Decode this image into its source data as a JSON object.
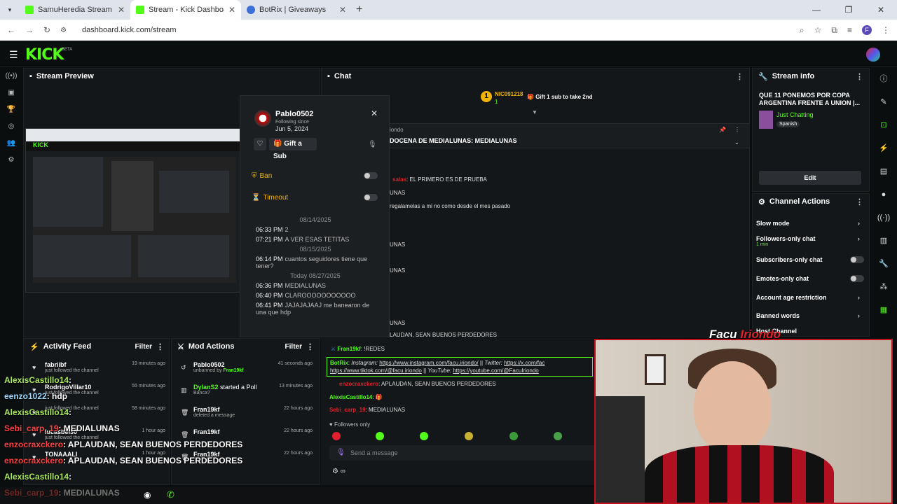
{
  "browser": {
    "tabs": [
      {
        "title": "SamuHeredia Stream - Watch L",
        "active": false
      },
      {
        "title": "Stream - Kick Dashboard",
        "active": true
      },
      {
        "title": "BotRix | Giveaways",
        "active": false
      }
    ],
    "url": "dashboard.kick.com/stream",
    "profile_initial": "F"
  },
  "kick": {
    "logo": "KICK",
    "beta": "BETA"
  },
  "stream_preview": {
    "title": "Stream Preview"
  },
  "popup": {
    "username": "Pablo0502",
    "following_since_label": "Following since",
    "following_since": "Jun 5, 2024",
    "gift_label": "Gift a Sub",
    "ban_label": "Ban",
    "timeout_label": "Timeout",
    "history": [
      {
        "type": "date",
        "text": "08/14/2025"
      },
      {
        "type": "msg",
        "time": "06:33 PM",
        "text": "2"
      },
      {
        "type": "msg",
        "time": "07:21 PM",
        "text": "A VER ESAS TETITAS"
      },
      {
        "type": "date",
        "text": "08/15/2025"
      },
      {
        "type": "msg",
        "time": "06:14 PM",
        "text": "cuantos seguidores tiene que tener?"
      },
      {
        "type": "date",
        "text": "Today 08/27/2025"
      },
      {
        "type": "msg",
        "time": "06:36 PM",
        "text": "MEDIALUNAS"
      },
      {
        "type": "msg",
        "time": "06:40 PM",
        "text": "CLAROOOOOOOOOOO"
      },
      {
        "type": "msg",
        "time": "06:41 PM",
        "text": "JAJAJAJAAJ me banearon de una que hdp"
      }
    ]
  },
  "chat": {
    "title": "Chat",
    "top_gifter": {
      "rank": "1",
      "name": "NIC091218",
      "count": "1",
      "cta": "Gift 1 sub to take 2nd"
    },
    "pinned_author": "iondo",
    "pinned_text": "DOCENA DE MEDIALUNAS: MEDIALUNAS",
    "messages": [
      {
        "user": "salas",
        "text": ": EL PRIMERO ES DE PRUEBA",
        "color": "#e0202c"
      },
      {
        "user": "",
        "text": "UNAS",
        "color": "#ddd"
      },
      {
        "user": "",
        "text": "regalamelas a mi no como desde el mes pasado",
        "color": "#ddd"
      },
      {
        "user": "",
        "text": "UNAS",
        "color": "#ddd"
      },
      {
        "user": "",
        "text": "UNAS",
        "color": "#ddd"
      },
      {
        "user": "",
        "text": "UNAS",
        "color": "#ddd"
      },
      {
        "user": "",
        "text": "LAUDAN, SEAN BUENOS PERDEDORES",
        "color": "#ddd"
      }
    ],
    "low": {
      "m1_user": "Fran19kf",
      "m1_text": ": !REDES",
      "bot_user": "BotRix",
      "bot_ig_label": "Instagram:",
      "bot_ig": "https://www.instagram.com/facu.iriondo/",
      "bot_tw_label": "Twitter:",
      "bot_tw": "https://x.com/fac",
      "bot_tt": "https://www.tiktok.com/@facu.iriondo",
      "bot_yt_label": "YouTube:",
      "bot_yt": "https://youtube.com/@FacuIriondo",
      "m3_user": "enzocraxckero",
      "m3_text": ": APLAUDAN, SEAN BUENOS PERDEDORES",
      "m4_user": "AlexisCastillo14",
      "m4_text": ":",
      "m5_user": "Sebi_carp_19",
      "m5_text": ": MEDIALUNAS",
      "followers_only": "Followers only",
      "send_placeholder": "Send a message"
    }
  },
  "activity": {
    "title": "Activity Feed",
    "filter": "Filter",
    "items": [
      {
        "name": "fabriibf",
        "sub": "just followed the channel",
        "time": "19 minutes ago"
      },
      {
        "name": "RodrigoVillar10",
        "sub": "just followed the channel",
        "time": "55 minutes ago"
      },
      {
        "name": "",
        "sub": "just followed the channel",
        "time": "58 minutes ago"
      },
      {
        "name": "lucasbel30",
        "sub": "just followed the channel",
        "time": "1 hour ago"
      },
      {
        "name": "TONAAALI",
        "sub": "",
        "time": "1 hour ago"
      }
    ]
  },
  "mod": {
    "title": "Mod Actions",
    "filter": "Filter",
    "items": [
      {
        "name": "Pablo0502",
        "sub": "unbanned by",
        "by": "Fran19kf",
        "time": "41 seconds ago"
      },
      {
        "name": "DylanS2",
        "action": " started a Poll",
        "sub": "Banca?",
        "time": "13 minutes ago"
      },
      {
        "name": "Fran19kf",
        "sub": "deleted a message",
        "time": "22 hours ago"
      },
      {
        "name": "Fran19kf",
        "sub": "",
        "time": "22 hours ago"
      },
      {
        "name": "Fran19kf",
        "sub": "",
        "time": "22 hours ago"
      }
    ]
  },
  "overlay_chat": [
    {
      "user": "AlexisCastillo14",
      "text": ":",
      "color": "#a8e85a"
    },
    {
      "user": "eenzo1022",
      "text": ": hdp",
      "color": "#9ad8ff"
    },
    {
      "user": "AlexisCastillo14",
      "text": ":",
      "color": "#a8e85a"
    },
    {
      "user": "Sebi_carp_19",
      "text": ": MEDIALUNAS",
      "color": "#ff4040"
    },
    {
      "user": "enzocraxckero",
      "text": ": APLAUDAN, SEAN BUENOS PERDEDORES",
      "color": "#ff4040"
    },
    {
      "user": "enzocraxckero",
      "text": ": APLAUDAN, SEAN BUENOS PERDEDORES",
      "color": "#ff4040"
    },
    {
      "user": "AlexisCastillo14",
      "text": ":",
      "color": "#a8e85a"
    },
    {
      "user": "Sebi_carp_19",
      "text": ": MEDIALUNAS",
      "color": "#ff4040"
    }
  ],
  "stream_info": {
    "title": "Stream info",
    "stream_title": "QUE 11 PONEMOS POR COPA ARGENTINA FRENTE A UNION |...",
    "category": "Just Chatting",
    "language": "Spanish",
    "edit": "Edit"
  },
  "channel_actions": {
    "title": "Channel Actions",
    "items": [
      {
        "label": "Slow mode",
        "kind": "arrow",
        "sub": ""
      },
      {
        "label": "Followers-only chat",
        "kind": "arrow",
        "sub": "1 min"
      },
      {
        "label": "Subscribers-only chat",
        "kind": "toggle",
        "sub": ""
      },
      {
        "label": "Emotes-only chat",
        "kind": "toggle",
        "sub": ""
      },
      {
        "label": "Account age restriction",
        "kind": "arrow",
        "sub": ""
      },
      {
        "label": "Banned words",
        "kind": "arrow",
        "sub": ""
      },
      {
        "label": "Host Channel",
        "kind": "none",
        "sub": ""
      }
    ]
  },
  "cam": {
    "title_a": "Facu",
    "title_b": "Iriondo"
  },
  "colors": {
    "kick_green": "#53fc18",
    "bg": "#0b0e0f",
    "panel": "#141719"
  }
}
